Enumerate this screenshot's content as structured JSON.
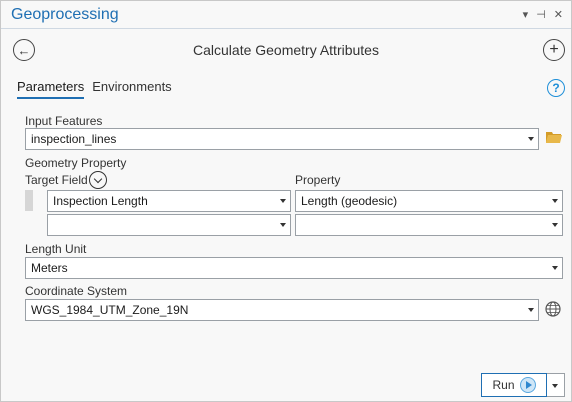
{
  "titlebar": {
    "title": "Geoprocessing",
    "icons": [
      "dropdown-icon",
      "pin-icon",
      "close-icon"
    ],
    "icon_glyphs": [
      "▾",
      "⊣",
      "✕"
    ]
  },
  "header": {
    "tool_title": "Calculate Geometry Attributes"
  },
  "tabs": [
    {
      "label": "Parameters",
      "active": true
    },
    {
      "label": "Environments",
      "active": false
    }
  ],
  "params": {
    "input_features_label": "Input Features",
    "input_features_value": "inspection_lines",
    "geometry_property_label": "Geometry Property",
    "target_field_label": "Target Field",
    "property_label": "Property",
    "rows": [
      {
        "target_field": "Inspection Length",
        "property": "Length (geodesic)"
      },
      {
        "target_field": "",
        "property": ""
      }
    ],
    "length_unit_label": "Length Unit",
    "length_unit_value": "Meters",
    "coord_system_label": "Coordinate System",
    "coord_system_value": "WGS_1984_UTM_Zone_19N"
  },
  "footer": {
    "run_label": "Run"
  },
  "colors": {
    "accent": "#1f6fb3",
    "help": "#1f8fd8",
    "folder": "#e8b84a"
  }
}
